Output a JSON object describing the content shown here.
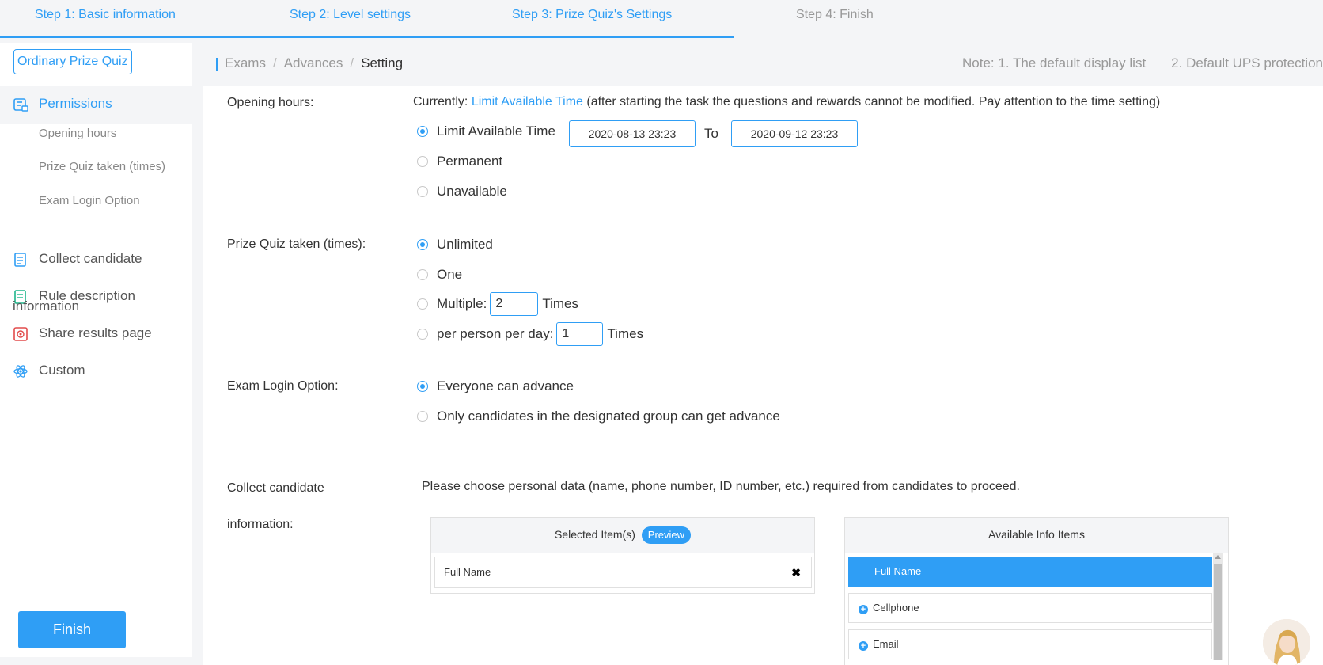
{
  "steps": [
    {
      "label": "Step 1: Basic information",
      "state": "done"
    },
    {
      "label": "Step 2: Level settings",
      "state": "done"
    },
    {
      "label": "Step 3:  Prize Quiz's Settings",
      "state": "current"
    },
    {
      "label": "Step 4: Finish",
      "state": "pending"
    }
  ],
  "sidebar": {
    "quiz_type": "Ordinary Prize Quiz",
    "nav": [
      {
        "label": "Permissions",
        "icon": "permissions-icon",
        "active": true
      },
      {
        "label": "Collect candidate",
        "icon": "clipboard-icon"
      },
      {
        "label": "Rule description",
        "icon": "document-icon"
      },
      {
        "label": "Share results page",
        "icon": "share-icon"
      },
      {
        "label": "Custom",
        "icon": "atom-icon"
      }
    ],
    "subitems": [
      "Opening hours",
      "Prize Quiz taken (times)",
      "Exam Login Option"
    ],
    "overlap_text": "information",
    "finish_label": "Finish"
  },
  "breadcrumb": {
    "items": [
      "Exams",
      "Advances",
      "Setting"
    ],
    "notes": [
      "Note: 1. The default display list",
      "2. Default UPS protection"
    ]
  },
  "opening_hours": {
    "label": "Opening hours:",
    "currently_prefix": "Currently:",
    "currently_value": "Limit Available Time",
    "currently_note": "(after starting the task the questions and rewards cannot be modified. Pay attention to the time setting)",
    "options": [
      "Limit Available Time",
      "Permanent",
      "Unavailable"
    ],
    "selected": "Limit Available Time",
    "start": "2020-08-13 23:23",
    "to_label": "To",
    "end": "2020-09-12 23:23"
  },
  "prize_quiz_taken": {
    "label": "Prize Quiz taken (times):",
    "options": [
      "Unlimited",
      "One",
      "Multiple:",
      "per person per day:"
    ],
    "selected": "Unlimited",
    "multiple_value": "2",
    "per_day_value": "1",
    "times_label": "Times"
  },
  "exam_login": {
    "label": "Exam Login Option:",
    "options": [
      "Everyone can advance",
      "Only candidates in the designated group can get advance"
    ],
    "selected": "Everyone can advance"
  },
  "collect": {
    "label_line1": "Collect candidate",
    "label_line2": "information:",
    "description": "Please choose personal data (name, phone number, ID number, etc.) required from candidates to proceed.",
    "selected_title": "Selected Item(s)",
    "preview_label": "Preview",
    "selected_items": [
      "Full Name"
    ],
    "available_title": "Available Info Items",
    "available_items": [
      "Full Name",
      "Cellphone",
      "Email"
    ]
  },
  "colors": {
    "accent": "#2f9ef5"
  }
}
